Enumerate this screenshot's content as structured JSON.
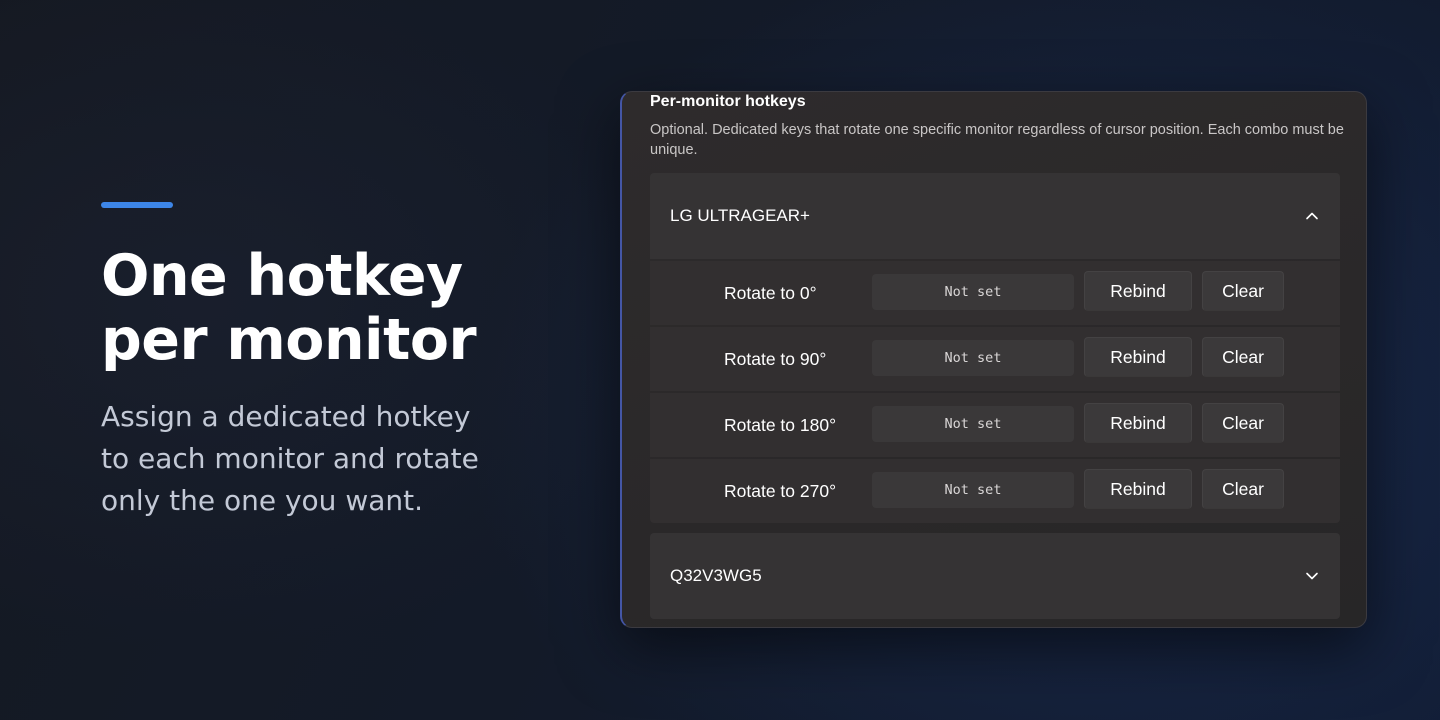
{
  "hero": {
    "headline": "One hotkey\nper monitor",
    "subtitle": "Assign a dedicated hotkey to each monitor and rotate only the one you want.",
    "accent_color": "#3d86e8"
  },
  "panel": {
    "section_title": "Per-monitor hotkeys",
    "section_description": "Optional. Dedicated keys that rotate one specific monitor regardless of cursor position. Each combo must be unique.",
    "monitors": [
      {
        "name": "LG ULTRAGEAR+",
        "expanded": true,
        "chevron": "chevron-up-icon",
        "rows": [
          {
            "label": "Rotate to 0°",
            "hotkey": "Not set",
            "rebind": "Rebind",
            "clear": "Clear"
          },
          {
            "label": "Rotate to 90°",
            "hotkey": "Not set",
            "rebind": "Rebind",
            "clear": "Clear"
          },
          {
            "label": "Rotate to 180°",
            "hotkey": "Not set",
            "rebind": "Rebind",
            "clear": "Clear"
          },
          {
            "label": "Rotate to 270°",
            "hotkey": "Not set",
            "rebind": "Rebind",
            "clear": "Clear"
          }
        ]
      },
      {
        "name": "Q32V3WG5",
        "expanded": false,
        "chevron": "chevron-down-icon"
      }
    ]
  }
}
